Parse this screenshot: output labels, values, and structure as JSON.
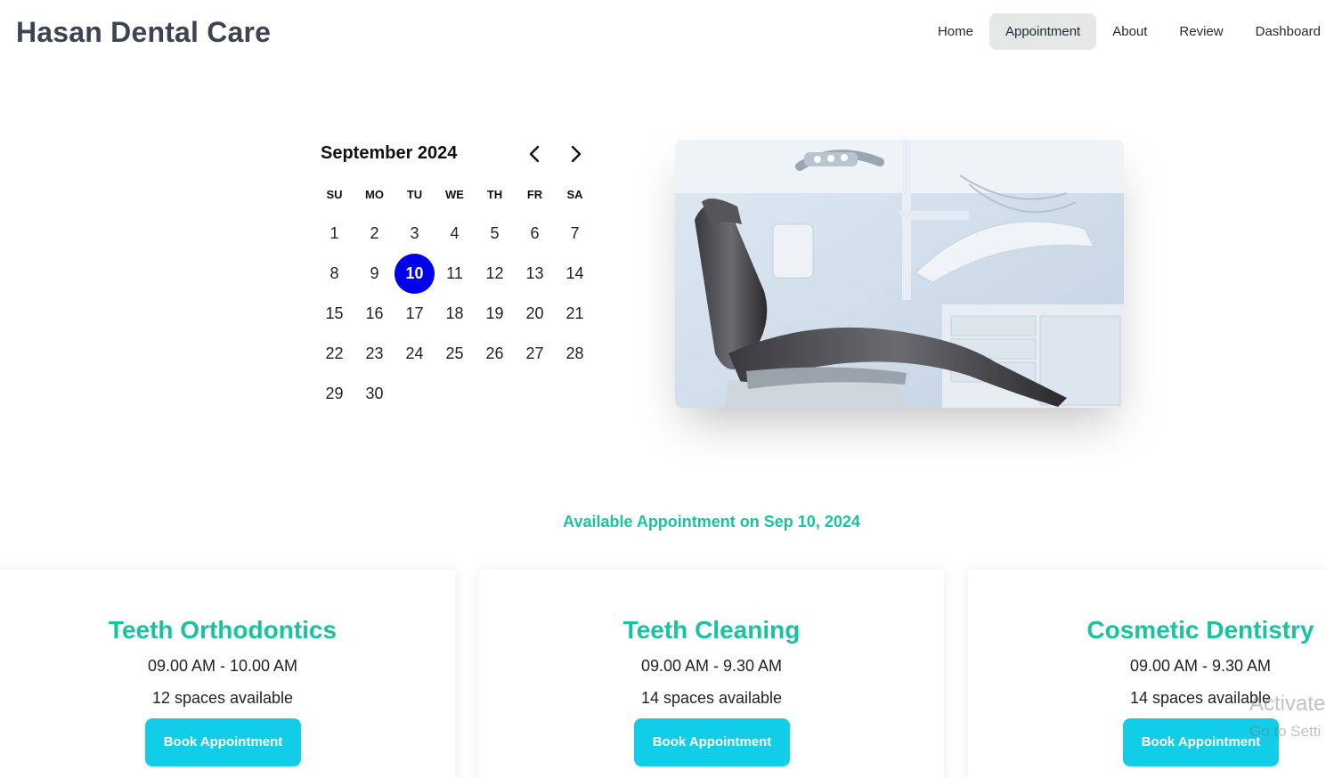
{
  "header": {
    "brand": "Hasan Dental Care",
    "nav": [
      "Home",
      "Appointment",
      "About",
      "Review",
      "Dashboard"
    ],
    "active_nav": "Appointment"
  },
  "calendar": {
    "month_label": "September 2024",
    "weekdays": [
      "SU",
      "MO",
      "TU",
      "WE",
      "TH",
      "FR",
      "SA"
    ],
    "first_weekday_index": 0,
    "days_in_month": 30,
    "selected_day": 10,
    "selected_color": "#0000ee"
  },
  "hero": {
    "icon": "dental-chair-photo"
  },
  "available_heading": "Available Appointment on Sep 10, 2024",
  "services": [
    {
      "title": "Teeth Orthodontics",
      "time": "09.00 AM - 10.00 AM",
      "spaces": "12 spaces available",
      "button": "Book Appointment"
    },
    {
      "title": "Teeth Cleaning",
      "time": "09.00 AM - 9.30 AM",
      "spaces": "14 spaces available",
      "button": "Book Appointment"
    },
    {
      "title": "Cosmetic Dentistry",
      "time": "09.00 AM - 9.30 AM",
      "spaces": "14 spaces available",
      "button": "Book Appointment"
    }
  ],
  "watermark": {
    "line1": "Activate",
    "line2": "Go to Setti"
  },
  "colors": {
    "accent": "#19c3a0",
    "button": "#12cde8",
    "nav_active_bg": "#e5e6e6"
  }
}
